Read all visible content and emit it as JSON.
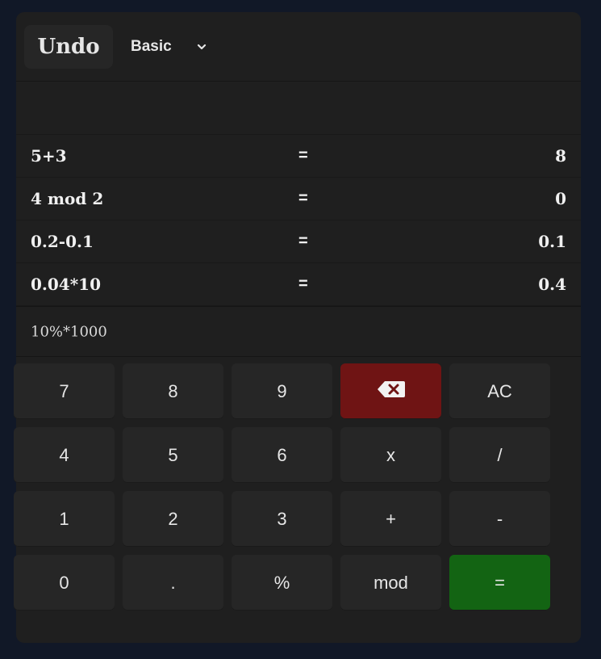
{
  "header": {
    "undo_label": "Undo",
    "mode": {
      "selected": "Basic",
      "icon": "chevron-down-icon"
    }
  },
  "input": {
    "value": ""
  },
  "history": [
    {
      "expression": "5+3",
      "equals": "=",
      "result": "8"
    },
    {
      "expression": "4 mod 2",
      "equals": "=",
      "result": "0"
    },
    {
      "expression": "0.2-0.1",
      "equals": "=",
      "result": "0.1"
    },
    {
      "expression": "0.04*10",
      "equals": "=",
      "result": "0.4"
    }
  ],
  "current_expression": "10%*1000",
  "keypad": {
    "k7": "7",
    "k8": "8",
    "k9": "9",
    "backspace_icon": "backspace-icon",
    "ac": "AC",
    "k4": "4",
    "k5": "5",
    "k6": "6",
    "multiply": "x",
    "divide": "/",
    "k1": "1",
    "k2": "2",
    "k3": "3",
    "plus": "+",
    "minus": "-",
    "k0": "0",
    "dot": ".",
    "percent": "%",
    "mod": "mod",
    "equals": "="
  },
  "colors": {
    "background": "#111827",
    "panel": "#1f1f1f",
    "key": "#262626",
    "backspace": "#6f1414",
    "equals": "#136413",
    "text": "#e6e6e6"
  }
}
